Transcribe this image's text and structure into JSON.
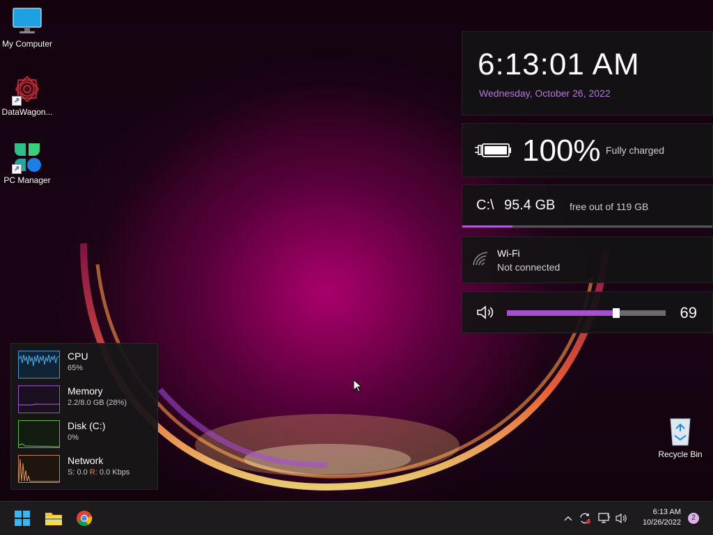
{
  "desktop": {
    "icons": [
      {
        "label": "My Computer",
        "icon": "monitor-icon"
      },
      {
        "label": "DataWagon...",
        "icon": "datawagon-logo-icon"
      },
      {
        "label": "PC Manager",
        "icon": "pc-manager-logo-icon"
      }
    ],
    "recycle_bin": {
      "label": "Recycle Bin",
      "icon": "recycle-bin-icon"
    }
  },
  "widgets": {
    "clock": {
      "time": "6:13:01 AM",
      "date": "Wednesday, October 26, 2022"
    },
    "battery": {
      "percent": "100%",
      "status": "Fully charged",
      "icon": "battery-charging-icon"
    },
    "disk": {
      "drive": "C:\\",
      "free": "95.4 GB",
      "total": "free out of 119 GB",
      "used_fraction": 0.2
    },
    "wifi": {
      "name": "Wi-Fi",
      "status": "Not connected",
      "icon": "wifi-icon"
    },
    "volume": {
      "level": "69",
      "fraction": 0.69,
      "icon": "speaker-icon"
    }
  },
  "perf_monitor": [
    {
      "name": "CPU",
      "value": "65%",
      "color": "#3b9ad6"
    },
    {
      "name": "Memory",
      "value": "2.2/8.0 GB (28%)",
      "color": "#9b4fc9"
    },
    {
      "name": "Disk (C:)",
      "value": "0%",
      "color": "#5fb83a"
    },
    {
      "name": "Network",
      "value_send_label": "S:",
      "value_send": "0.0",
      "value_recv_label": "R:",
      "value_recv": "0.0 Kbps",
      "color": "#c9814a"
    }
  ],
  "taskbar": {
    "apps": [
      "start-icon",
      "file-explorer-icon",
      "chrome-icon"
    ],
    "tray": {
      "time": "6:13 AM",
      "date": "10/26/2022",
      "notifications": "2",
      "icons": [
        "chevron-up-icon",
        "sync-icon",
        "network-icon",
        "volume-icon"
      ]
    }
  },
  "colors": {
    "accent": "#b476d8",
    "panel": "#141214",
    "taskbar": "#1d1b1e"
  }
}
